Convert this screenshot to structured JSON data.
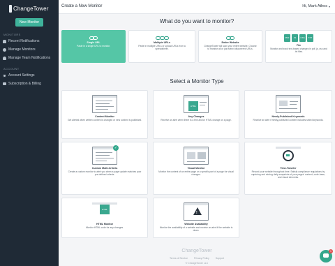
{
  "sidebar": {
    "logo_text": "ChangeTower",
    "new_monitor_label": "New Monitor",
    "sections": [
      {
        "label": "MONITORS",
        "items": [
          {
            "label": "Recent Notifications",
            "icon": "bell-icon"
          },
          {
            "label": "Manage Monitors",
            "icon": "eye-icon"
          },
          {
            "label": "Manage Team Notifications",
            "icon": "users-icon"
          }
        ]
      },
      {
        "label": "ACCOUNT",
        "items": [
          {
            "label": "Account Settings",
            "icon": "gear-icon"
          },
          {
            "label": "Subscription & Billing",
            "icon": "credit-card-icon"
          }
        ]
      }
    ]
  },
  "topbar": {
    "title": "Create a New Monitor",
    "user_greeting": "Hi, Mark Athos"
  },
  "what_section": {
    "heading": "What do you want to monitor?",
    "options": [
      {
        "title": "Single URL",
        "desc": "Paste in a single URL to monitor.",
        "selected": true
      },
      {
        "title": "Multiple URLs",
        "desc": "Paste in multiple URLs or upload URLs from a spreadsheet."
      },
      {
        "title": "Entire Website",
        "desc": "ChangeTower will scan your entire website. Choose to monitor all or just select discovered URLs."
      },
      {
        "title": "File",
        "desc": "Monitor and track text-based changes in pdf, js, css and .txt files.",
        "file_types": [
          "PDF",
          "JS",
          "CSS",
          "TXT"
        ]
      }
    ]
  },
  "type_section": {
    "heading": "Select a Monitor Type",
    "types": [
      {
        "title": "Content Monitor",
        "desc": "Get alerted when written content is changed or new content is published."
      },
      {
        "title": "Any Changes",
        "desc": "Receive an alert when there is a text and/or HTML change on a page."
      },
      {
        "title": "Newly-Published Keywords",
        "desc": "Receive an alert if newly-published content includes select keywords."
      },
      {
        "title": "Custom Multi-Criteria",
        "desc": "Create a custom monitor to alert you when a page update matches your pre-defined criteria."
      },
      {
        "title": "Visual Monitor",
        "desc": "Monitor the content of an entire page or a specific part of a page for visual changes."
      },
      {
        "title": "Time-Traveler",
        "desc": "Record your website throughout time. Satisfy compliance regulations by capturing and storing daily snapshots of your pages' content, code-base, and visual elements."
      },
      {
        "title": "HTML Monitor",
        "desc": "Monitor HTML code for any changes."
      },
      {
        "title": "Website Availability",
        "desc": "Monitor the availability of a website and receive an alert if the website is down."
      }
    ]
  },
  "footer": {
    "logo_text": "ChangeTower",
    "links": [
      "Terms of Service",
      "Privacy Policy",
      "Support"
    ],
    "copyright": "© ChangeTower LLC"
  },
  "chat": {
    "badge": "1"
  },
  "colors": {
    "accent": "#3fb39b",
    "sidebar": "#1f2a36"
  }
}
